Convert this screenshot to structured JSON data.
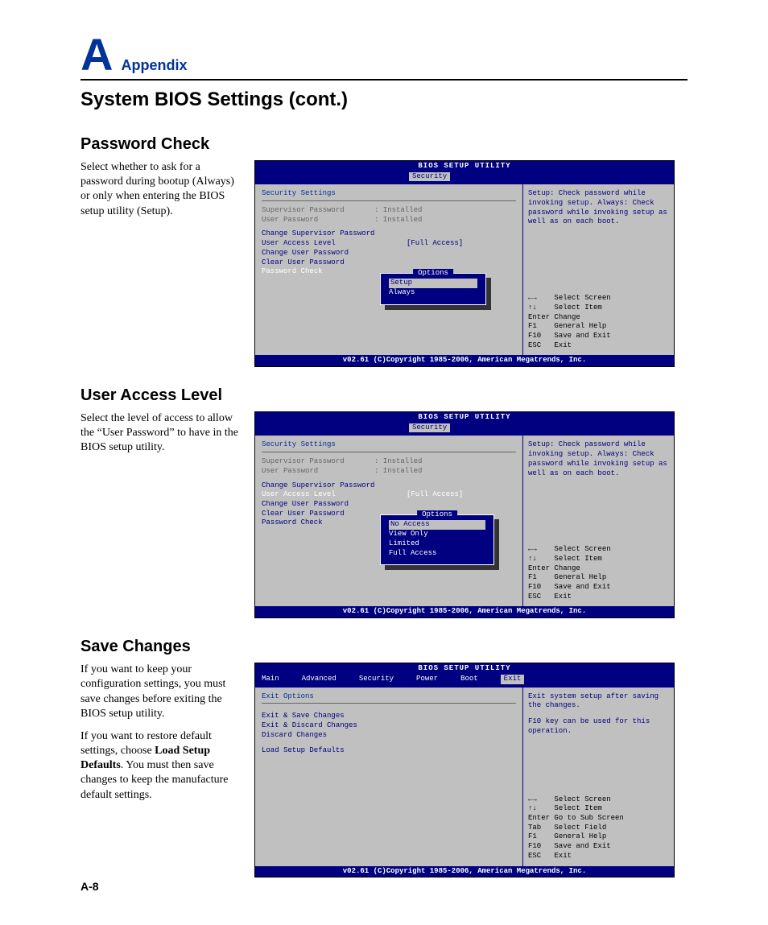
{
  "header": {
    "letter": "A",
    "word": "Appendix"
  },
  "page_title": "System BIOS Settings (cont.)",
  "page_number": "A-8",
  "bios_common": {
    "title": "BIOS SETUP UTILITY",
    "footer": "v02.61 (C)Copyright 1985-2006, American Megatrends, Inc.",
    "help_text": "Setup: Check password while invoking setup. Always: Check password while invoking setup as well as on each boot.",
    "nav1": {
      "arrows_lr": "←→",
      "arrows_ud": "↑↓",
      "select_screen": "Select Screen",
      "select_item": "Select Item",
      "enter": "Enter",
      "change": "Change",
      "f1": "F1",
      "gen_help": "General Help",
      "f10": "F10",
      "save_exit": "Save and Exit",
      "esc": "ESC",
      "exit": "Exit"
    }
  },
  "sec1": {
    "heading": "Password Check",
    "copy": "Select whether to ask for a password during bootup (Always) or only when entering the BIOS setup utility (Setup).",
    "tab": "Security",
    "panel_title": "Security Settings",
    "sup_label": "Supervisor Password",
    "sup_val": ": Installed",
    "user_label": "User Password",
    "user_val": ": Installed",
    "l1": "Change Supervisor Password",
    "l2": "User Access Level",
    "l2v": "[Full Access]",
    "l3": "Change User Password",
    "l4": "Clear User Password",
    "l5": "Password Check",
    "popup_title": "Options",
    "opt1": "Setup",
    "opt2": "Always"
  },
  "sec2": {
    "heading": "User Access Level",
    "copy": "Select the level of access to allow the “User Password” to have in the BIOS setup utility.",
    "tab": "Security",
    "panel_title": "Security Settings",
    "sup_label": "Supervisor Password",
    "sup_val": ": Installed",
    "user_label": "User Password",
    "user_val": ": Installed",
    "l1": "Change Supervisor Password",
    "l2": "User Access Level",
    "l2v": "[Full Access]",
    "l3": "Change User Password",
    "l4": "Clear User Password",
    "l5": "Password Check",
    "popup_title": "Options",
    "opt1": "No Access",
    "opt2": "View Only",
    "opt3": "Limited",
    "opt4": "Full Access"
  },
  "sec3": {
    "heading": "Save Changes",
    "copy1": "If you want to keep your configuration settings, you must save changes before exiting the BIOS setup utility.",
    "copy2a": "If you want to restore default settings, choose ",
    "copy2b": "Load Setup Defaults",
    "copy2c": ". You must then save changes to keep the manufacture default settings.",
    "tabs": {
      "m": "Main",
      "a": "Advanced",
      "s": "Security",
      "p": "Power",
      "b": "Boot",
      "e": "Exit"
    },
    "panel_title": "Exit Options",
    "l1": "Exit & Save Changes",
    "l2": "Exit & Discard Changes",
    "l3": "Discard Changes",
    "l4": "Load Setup Defaults",
    "help1": "Exit system setup after saving the changes.",
    "help2": "F10 key can be used for this operation.",
    "nav": {
      "enter_act": "Go to Sub Screen",
      "tab": "Tab",
      "tab_act": "Select Field"
    }
  }
}
